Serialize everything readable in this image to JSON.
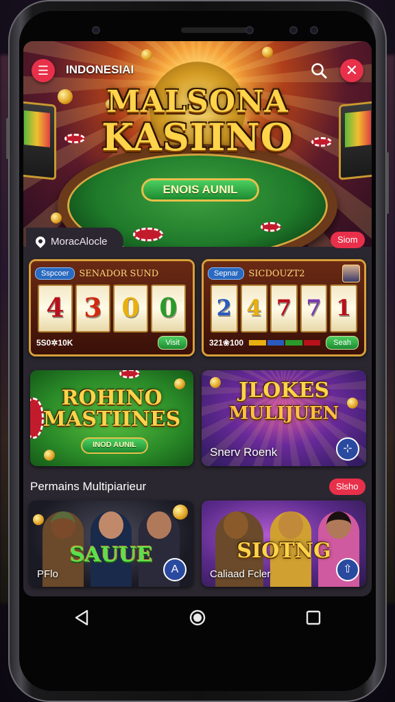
{
  "header": {
    "brand": "INDONESIAI",
    "menu_icon": "menu-icon",
    "search_icon": "search-icon",
    "close_icon": "close-icon"
  },
  "hero": {
    "title_line1": "MALSONA",
    "title_line2": "KASIINO",
    "cta_label": "ENOIS AUNIL"
  },
  "location": {
    "label": "MoracAlocle",
    "badge": "Siom"
  },
  "slots": [
    {
      "tag": "Sspcoer",
      "title": "SENADOR SUND",
      "reels": [
        "4",
        "3",
        "0",
        "0"
      ],
      "reel_colors": [
        "#b8101c",
        "#d02a10",
        "#e8b010",
        "#2a9a2a"
      ],
      "value": "5S0✲10K",
      "button": "Visit"
    },
    {
      "tag": "Sepnar",
      "title": "SICDOUZT2",
      "reels": [
        "2",
        "4",
        "7",
        "7",
        "1"
      ],
      "reel_colors": [
        "#2a5ac0",
        "#e8b010",
        "#b8101c",
        "#7a3ab0",
        "#b8101c"
      ],
      "value": "321❀100",
      "button": "Seah"
    }
  ],
  "featured": [
    {
      "title_line1": "ROHINO",
      "title_line2": "MASTIINES",
      "button": "INOD AUNIL"
    },
    {
      "title_line1": "JLOKES",
      "title_line2": "MULIJUEN",
      "caption": "Snerv Roenk"
    }
  ],
  "multiplayer": {
    "title": "Permains Multipiarieur",
    "badge": "Slsho",
    "cards": [
      {
        "art_title": "SAUUE",
        "caption": "PFlo"
      },
      {
        "art_title": "SIOTNG",
        "caption": "Caliaad Fcler"
      }
    ]
  },
  "navbar": {
    "back_icon": "back-icon",
    "home_icon": "home-icon",
    "recents_icon": "recents-icon"
  },
  "colors": {
    "accent_red": "#e8304a",
    "screen_bg": "#2b2730",
    "gold": "#ffd34a",
    "play_blue": "#2a4aa0"
  }
}
